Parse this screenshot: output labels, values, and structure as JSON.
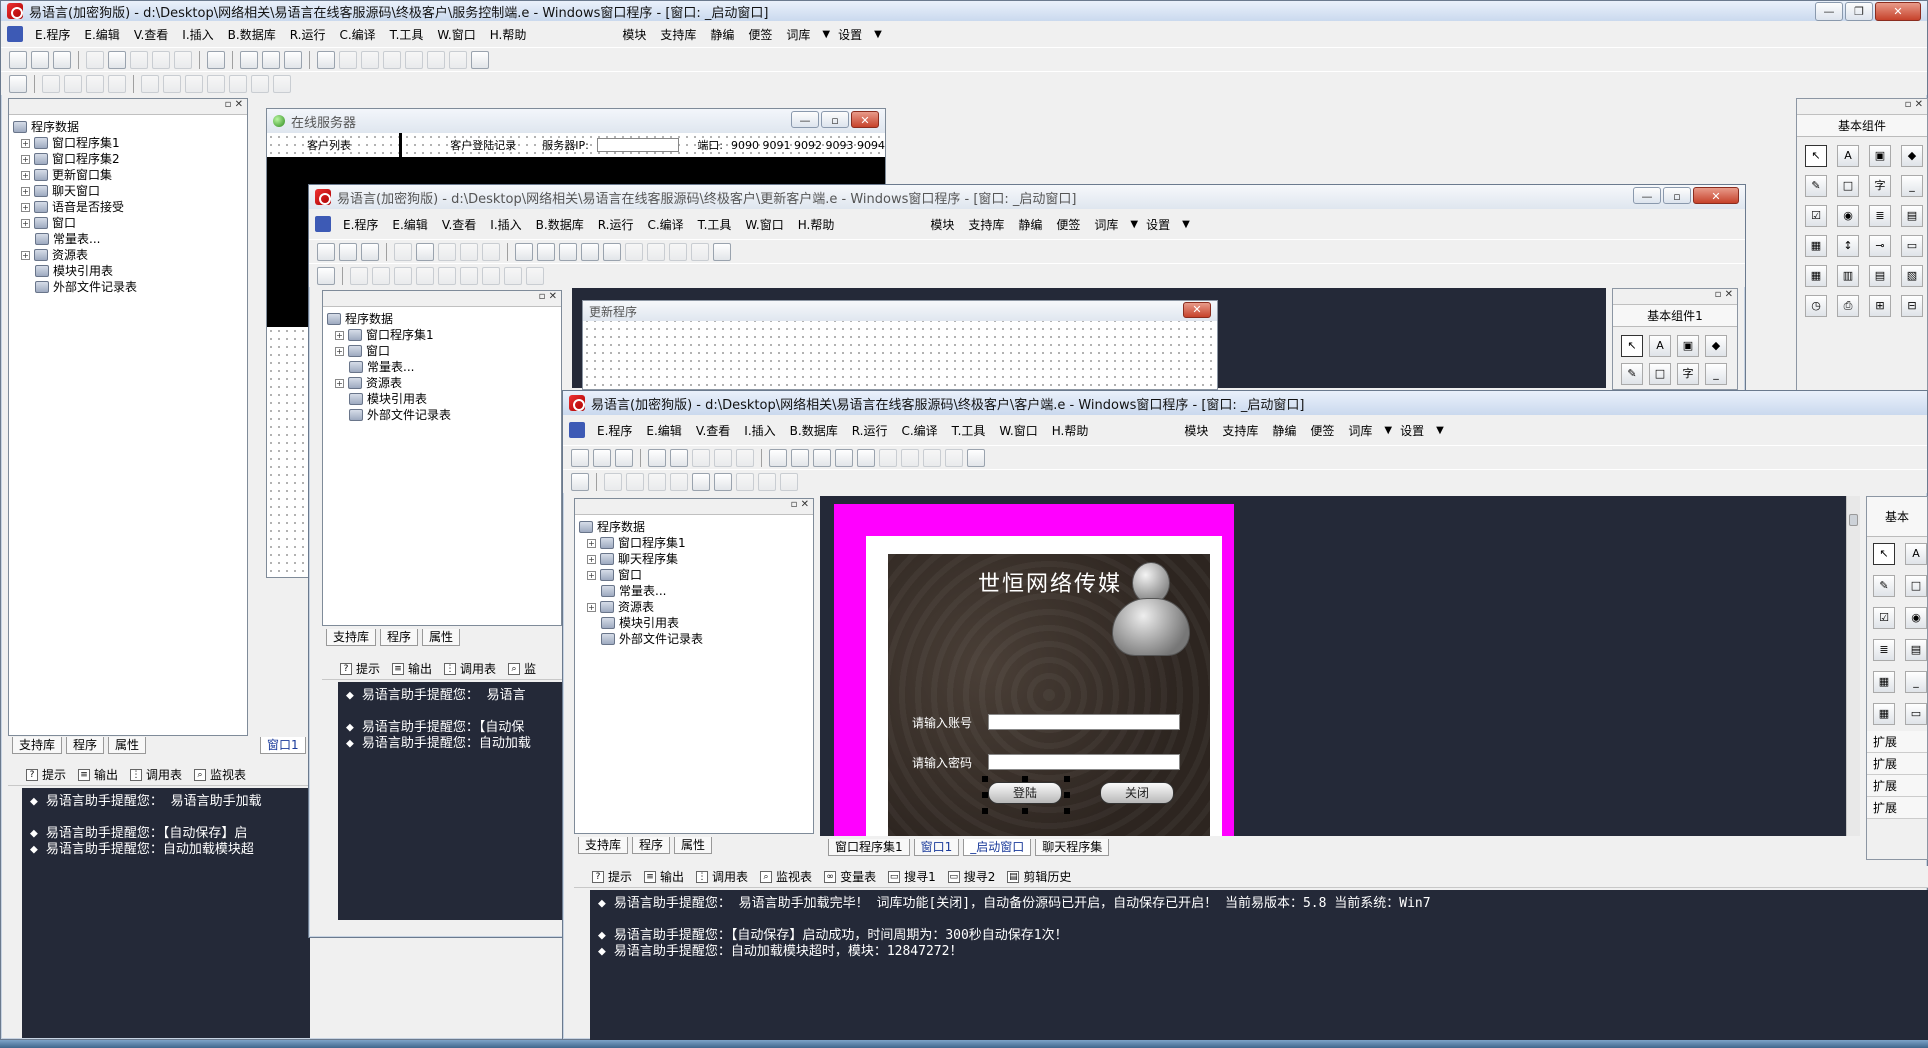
{
  "back_window": {
    "title": "易语言(加密狗版) - d:\\Desktop\\网络相关\\易语言在线客服源码\\终极客户\\服务控制端.e - Windows窗口程序 - [窗口: _启动窗口]",
    "menu": [
      "E.程序",
      "E.编辑",
      "V.查看",
      "I.插入",
      "B.数据库",
      "R.运行",
      "C.编译",
      "T.工具",
      "W.窗口",
      "H.帮助"
    ],
    "menu_right": [
      "模块",
      "支持库",
      "静编",
      "便签",
      "词库",
      "设置"
    ],
    "tree_root": "程序数据",
    "tree": [
      "窗口程序集1",
      "窗口程序集2",
      "更新窗口集",
      "聊天窗口",
      "语音是否接受",
      "窗口",
      "常量表...",
      "资源表",
      "模块引用表",
      "外部文件记录表"
    ],
    "tabs": [
      "支持库",
      "程序",
      "属性"
    ],
    "doc_tab": "窗口1",
    "output_tabs": [
      "提示",
      "输出",
      "调用表",
      "监视表"
    ],
    "output_lines": [
      "易语言助手提醒您：  易语言助手加载",
      "易语言助手提醒您：【自动保存】启",
      "易语言助手提醒您：自动加载模块超"
    ],
    "server_form": {
      "title": "在线服务器",
      "col1": "客户列表",
      "col2": "客户登陆记录",
      "ip_label": "服务器IP:",
      "port_label": "端口:",
      "ports": "9090 9091 9092 9093 9094"
    },
    "components_title": "基本组件"
  },
  "mid_window": {
    "title": "易语言(加密狗版) - d:\\Desktop\\网络相关\\易语言在线客服源码\\终极客户\\更新客户端.e - Windows窗口程序 - [窗口: _启动窗口]",
    "menu": [
      "E.程序",
      "E.编辑",
      "V.查看",
      "I.插入",
      "B.数据库",
      "R.运行",
      "C.编译",
      "T.工具",
      "W.窗口",
      "H.帮助"
    ],
    "menu_right": [
      "模块",
      "支持库",
      "静编",
      "便签",
      "词库",
      "设置"
    ],
    "tree_root": "程序数据",
    "tree": [
      "窗口程序集1",
      "窗口",
      "常量表...",
      "资源表",
      "模块引用表",
      "外部文件记录表"
    ],
    "tabs": [
      "支持库",
      "程序",
      "属性"
    ],
    "update_form_title": "更新程序",
    "output_tabs": [
      "提示",
      "输出",
      "调用表",
      "监"
    ],
    "output_lines": [
      "易语言助手提醒您：  易语言",
      "易语言助手提醒您：【自动保",
      "易语言助手提醒您：自动加载"
    ],
    "components_title": "基本组件1"
  },
  "front_window": {
    "title": "易语言(加密狗版) - d:\\Desktop\\网络相关\\易语言在线客服源码\\终极客户\\客户端.e - Windows窗口程序 - [窗口: _启动窗口]",
    "menu": [
      "E.程序",
      "E.编辑",
      "V.查看",
      "I.插入",
      "B.数据库",
      "R.运行",
      "C.编译",
      "T.工具",
      "W.窗口",
      "H.帮助"
    ],
    "menu_right": [
      "模块",
      "支持库",
      "静编",
      "便签",
      "词库",
      "设置"
    ],
    "tree_root": "程序数据",
    "tree": [
      "窗口程序集1",
      "聊天程序集",
      "窗口",
      "常量表...",
      "资源表",
      "模块引用表",
      "外部文件记录表"
    ],
    "tabs": [
      "支持库",
      "程序",
      "属性"
    ],
    "doc_tabs": [
      "窗口程序集1",
      "窗口1",
      "_启动窗口",
      "聊天程序集"
    ],
    "output_tabs": [
      "提示",
      "输出",
      "调用表",
      "监视表",
      "变量表",
      "搜寻1",
      "搜寻2",
      "剪辑历史"
    ],
    "output_lines": [
      "易语言助手提醒您：  易语言助手加载完毕！ 词库功能[关闭]，自动备份源码已开启，自动保存已开启！ 当前易版本：5.8  当前系统：Win7",
      "",
      "易语言助手提醒您：【自动保存】启动成功，时间周期为：300秒自动保存1次！",
      "易语言助手提醒您：自动加载模块超时，模块：12847272！"
    ],
    "login_form": {
      "brand": "世恒网络传媒",
      "account_label": "请输入账号",
      "password_label": "请输入密码",
      "login_button": "登陆",
      "close_button": "关闭"
    },
    "components_title": "基本",
    "ext_items": [
      "扩展",
      "扩展",
      "扩展",
      "扩展"
    ]
  }
}
